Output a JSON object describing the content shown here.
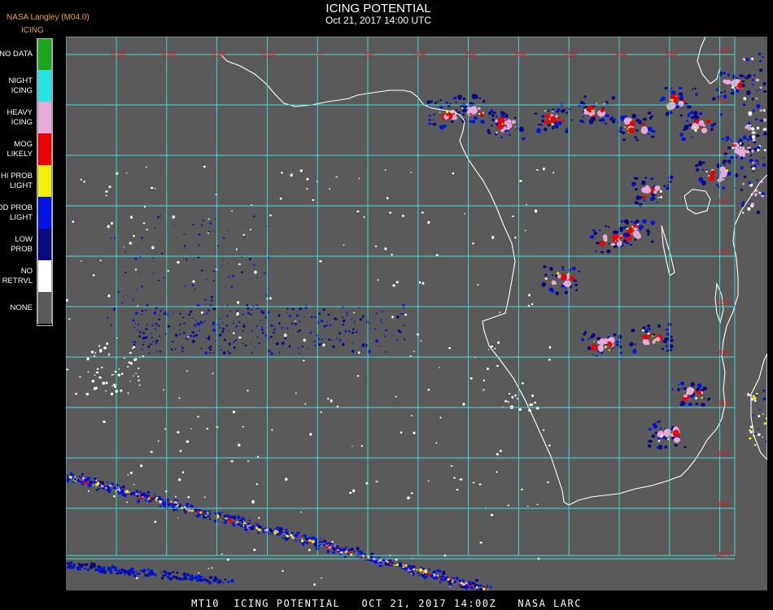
{
  "header": {
    "source_label": "NASA Langley (M04.0)",
    "title": "ICING POTENTIAL",
    "subtitle": "Oct 21, 2017 14:00 UTC"
  },
  "legend": {
    "title": "ICING",
    "items": [
      {
        "label": "NO DATA",
        "color": "#1aa81a"
      },
      {
        "label": "NIGHT\nICING",
        "color": "#22e6e6"
      },
      {
        "label": "HEAVY\nICING",
        "color": "#e8a8d8"
      },
      {
        "label": "MOG\nLIKELY",
        "color": "#ee0000"
      },
      {
        "label": "HI PROB\nLIGHT",
        "color": "#f2f200"
      },
      {
        "label": "MOD PROB\nLIGHT",
        "color": "#0014e6"
      },
      {
        "label": "LOW\nPROB",
        "color": "#0a0a80"
      },
      {
        "label": "NO\nRETRVL",
        "color": "#ffffff"
      },
      {
        "label": "NONE",
        "color": "#5a5a5a"
      }
    ]
  },
  "map": {
    "background": "#5a5a5a",
    "grid_color": "#40e0e0",
    "coast_color": "#ffffff",
    "lon_labels": [
      "40W",
      "30W",
      "20W",
      "10W",
      "0",
      "5E",
      "10E",
      "15E",
      "20E",
      "25E",
      "30E",
      "35E"
    ],
    "lat_labels": [
      "10N",
      "5N",
      "0",
      "5S",
      "10S",
      "15S",
      "20S",
      "25S",
      "30S",
      "35S",
      "40S"
    ],
    "label_color": "#dd2020"
  },
  "footer": {
    "text": "MT10  ICING POTENTIAL   OCT 21, 2017 14:00Z   NASA LARC"
  }
}
